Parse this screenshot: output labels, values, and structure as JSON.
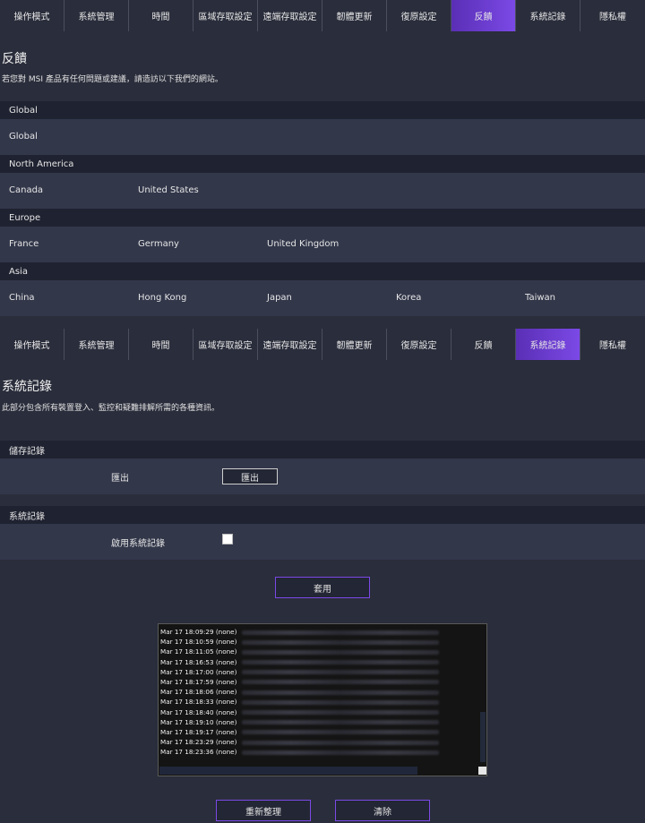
{
  "tabs_top": [
    {
      "label": "操作模式"
    },
    {
      "label": "系統管理"
    },
    {
      "label": "時間"
    },
    {
      "label": "區域存取設定"
    },
    {
      "label": "遠端存取設定"
    },
    {
      "label": "韌體更新"
    },
    {
      "label": "復原設定"
    },
    {
      "label": "反饋"
    },
    {
      "label": "系統記錄"
    },
    {
      "label": "隱私權"
    }
  ],
  "tabs_top_active": 7,
  "feedback": {
    "title": "反饋",
    "description": "若您對 MSI 產品有任何問題或建議，請造訪以下我們的網站。",
    "regions": [
      {
        "name": "Global",
        "sites": [
          "Global"
        ]
      },
      {
        "name": "North America",
        "sites": [
          "Canada",
          "United States"
        ]
      },
      {
        "name": "Europe",
        "sites": [
          "France",
          "Germany",
          "United Kingdom"
        ]
      },
      {
        "name": "Asia",
        "sites": [
          "China",
          "Hong Kong",
          "Japan",
          "Korea",
          "Taiwan"
        ]
      }
    ]
  },
  "tabs_bottom": [
    {
      "label": "操作模式"
    },
    {
      "label": "系統管理"
    },
    {
      "label": "時間"
    },
    {
      "label": "區域存取設定"
    },
    {
      "label": "遠端存取設定"
    },
    {
      "label": "韌體更新"
    },
    {
      "label": "復原設定"
    },
    {
      "label": "反饋"
    },
    {
      "label": "系統記錄"
    },
    {
      "label": "隱私權"
    }
  ],
  "tabs_bottom_active": 8,
  "syslog": {
    "title": "系統記錄",
    "description": "此部分包含所有裝置登入、監控和疑難排解所需的各種資訊。",
    "storage_section": "儲存記錄",
    "export_label": "匯出",
    "export_button": "匯出",
    "log_section": "系統記錄",
    "enable_label": "啟用系統記錄",
    "enable_checked": false,
    "apply_button": "套用",
    "log_lines": [
      "Mar 17 18:09:29 (none)",
      "Mar 17 18:10:59 (none)",
      "Mar 17 18:11:05 (none)",
      "Mar 17 18:16:53 (none)",
      "Mar 17 18:17:00 (none)",
      "Mar 17 18:17:59 (none)",
      "Mar 17 18:18:06 (none)",
      "Mar 17 18:18:33 (none)",
      "Mar 17 18:18:40 (none)",
      "Mar 17 18:19:10 (none)",
      "Mar 17 18:19:17 (none)",
      "Mar 17 18:23:29 (none)",
      "Mar 17 18:23:36 (none)"
    ],
    "refresh_button": "重新整理",
    "clear_button": "清除"
  },
  "colors": {
    "accent": "#7b49e6",
    "accent_dark": "#5a2fb5",
    "bg": "#2a2d3b",
    "row": "#32374a",
    "bar": "#1f2230"
  }
}
